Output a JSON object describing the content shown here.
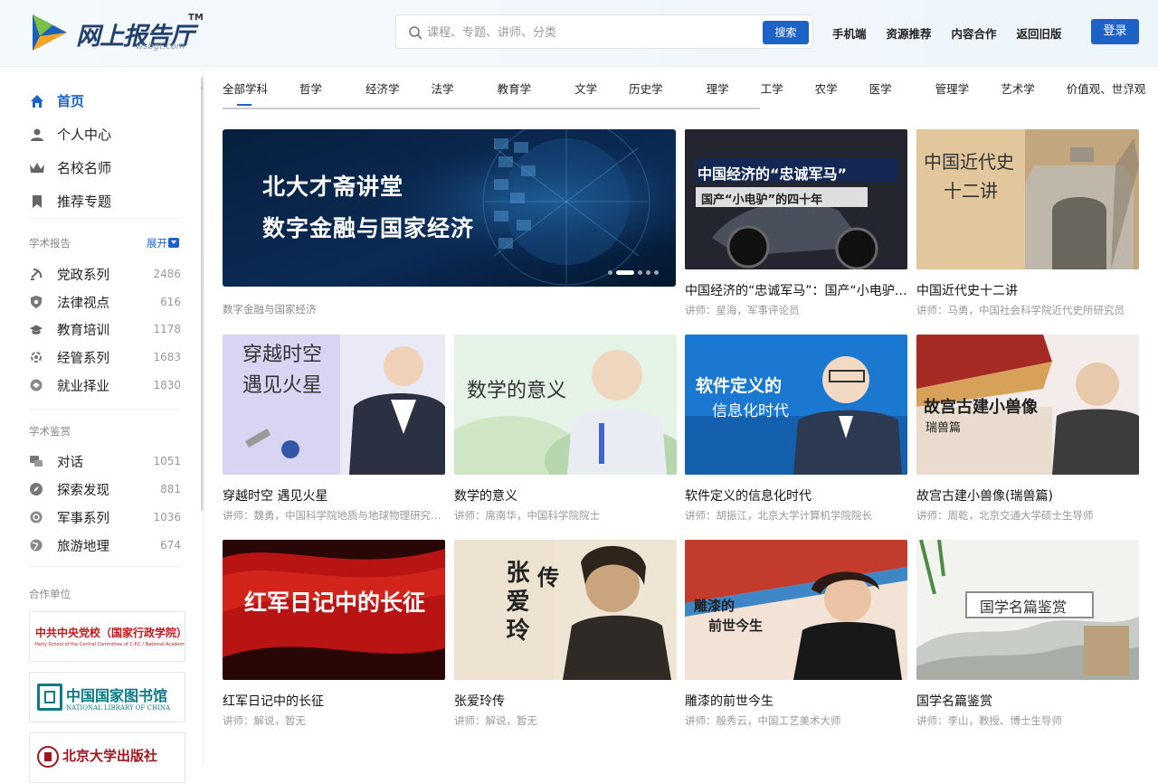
{
  "header": {
    "logo_text": "网上报告厅",
    "logo_tm": "TM",
    "logo_domain": "wsbgt.com",
    "search_placeholder": "课程、专题、讲师、分类",
    "search_button": "搜索",
    "nav": [
      "手机端",
      "资源推荐",
      "内容合作",
      "返回旧版"
    ],
    "login": "登录"
  },
  "sidebar": {
    "main_items": [
      {
        "label": "首页",
        "icon": "home-icon",
        "active": true
      },
      {
        "label": "个人中心",
        "icon": "user-icon",
        "active": false
      },
      {
        "label": "名校名师",
        "icon": "crown-icon",
        "active": false
      },
      {
        "label": "推荐专题",
        "icon": "bookmark-icon",
        "active": false
      }
    ],
    "academic_report": {
      "title": "学术报告",
      "expand": "展开",
      "items": [
        {
          "label": "党政系列",
          "count": "2486",
          "icon": "party-icon"
        },
        {
          "label": "法律视点",
          "count": "616",
          "icon": "shield-icon"
        },
        {
          "label": "教育培训",
          "count": "1178",
          "icon": "graduation-cap-icon"
        },
        {
          "label": "经管系列",
          "count": "1683",
          "icon": "gear-icon"
        },
        {
          "label": "就业择业",
          "count": "1830",
          "icon": "handshake-icon"
        }
      ]
    },
    "academic_appreciation": {
      "title": "学术鉴赏",
      "items": [
        {
          "label": "对话",
          "count": "1051",
          "icon": "chat-icon"
        },
        {
          "label": "探索发现",
          "count": "881",
          "icon": "compass-icon"
        },
        {
          "label": "军事系列",
          "count": "1036",
          "icon": "military-icon"
        },
        {
          "label": "旅游地理",
          "count": "674",
          "icon": "globe-icon"
        }
      ]
    },
    "partners": {
      "title": "合作单位",
      "items": [
        {
          "name": "中共中央党校（国家行政学院）",
          "sub": "Party School of the Central Committee of C.P.C / National Academy of Governance",
          "icon": "party-school-logo"
        },
        {
          "name": "中国国家图书馆",
          "sub": "NATIONAL LIBRARY OF CHINA",
          "icon": "national-library-logo"
        },
        {
          "name": "北京大学出版社",
          "sub": "",
          "icon": "pku-press-logo"
        }
      ]
    }
  },
  "subjects": [
    "全部学科",
    "哲学",
    "经济学",
    "法学",
    "教育学",
    "文学",
    "历史学",
    "理学",
    "工学",
    "农学",
    "医学",
    "管理学",
    "艺术学",
    "价值观、世界观"
  ],
  "banner": {
    "line1": "北大才斋讲堂",
    "line2": "数字金融与国家经济",
    "caption": "数字金融与国家经济"
  },
  "cards": [
    {
      "title": "中国经济的“忠诚军马”：国产“小电驴”的四十年",
      "lecturer": "讲师：星海，军事评论员",
      "overlay1": "中国经济的“忠诚军马”",
      "overlay2": "国产“小电驴”的四十年"
    },
    {
      "title": "中国近代史十二讲",
      "lecturer": "讲师：马勇，中国社会科学院近代史所研究员",
      "overlay1": "中国近代史",
      "overlay2": "十二讲"
    },
    {
      "title": "穿越时空 遇见火星",
      "lecturer": "讲师：魏勇，中国科学院地质与地球物理研究所研究员",
      "overlay1": "穿越时空",
      "overlay2": "遇见火星"
    },
    {
      "title": "数学的意义",
      "lecturer": "讲师：席南华，中国科学院院士",
      "overlay1": "数学的意义",
      "overlay2": ""
    },
    {
      "title": "软件定义的信息化时代",
      "lecturer": "讲师：胡振江，北京大学计算机学院院长",
      "overlay1": "软件定义的",
      "overlay2": "信息化时代"
    },
    {
      "title": "故宫古建小兽像(瑞兽篇)",
      "lecturer": "讲师：周乾，北京交通大学硕士生导师",
      "overlay1": "故宫古建小兽像",
      "overlay2": "瑞兽篇"
    },
    {
      "title": "红军日记中的长征",
      "lecturer": "讲师：解说，暂无",
      "overlay1": "红军日记中的长征",
      "overlay2": ""
    },
    {
      "title": "张爱玲传",
      "lecturer": "讲师：解说，暂无",
      "overlay1": "张爱玲",
      "overlay2": "传"
    },
    {
      "title": "雕漆的前世今生",
      "lecturer": "讲师：殷秀云，中国工艺美术大师",
      "overlay1": "雕漆的",
      "overlay2": "前世今生"
    },
    {
      "title": "国学名篇鉴赏",
      "lecturer": "讲师：李山，教授、博士生导师",
      "overlay1": "国学名篇鉴赏",
      "overlay2": ""
    }
  ]
}
